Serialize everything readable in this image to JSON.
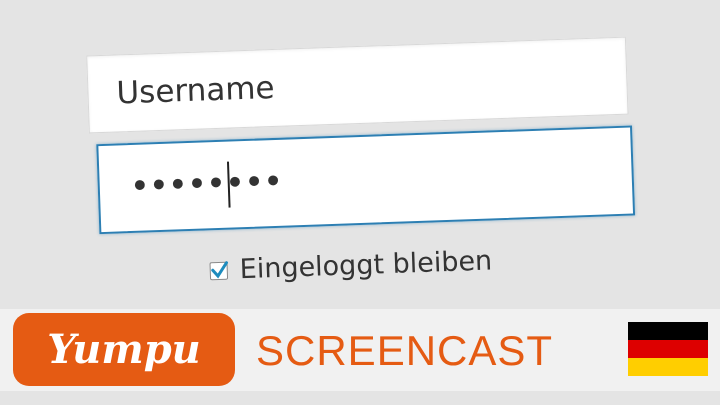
{
  "login": {
    "username_value": "Username",
    "password_value": "••••••••",
    "remember_me_label": "Eingeloggt bleiben",
    "remember_me_checked": true
  },
  "banner": {
    "logo_text": "Yumpu",
    "title": "SCREENCAST",
    "flag_icon": "germany-flag-icon",
    "flag_colors": [
      "#000000",
      "#dd0000",
      "#ffce00"
    ],
    "accent": "#e55b13"
  }
}
